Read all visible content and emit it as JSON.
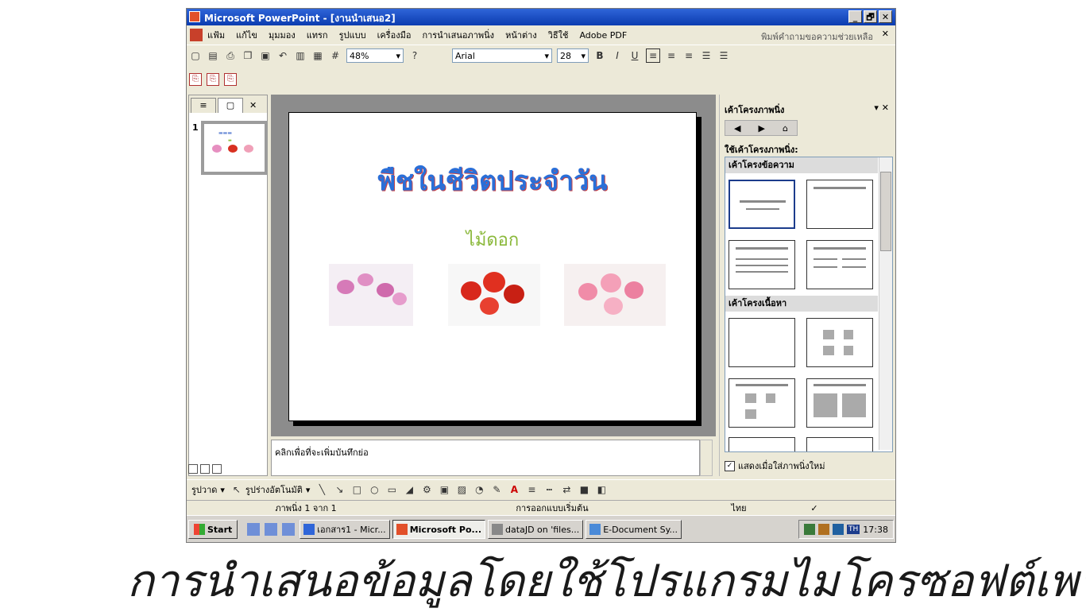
{
  "window": {
    "title": "Microsoft PowerPoint - [งานนำเสนอ2]",
    "buttons": [
      "_",
      "🗗",
      "✕"
    ]
  },
  "menu": {
    "items": [
      "แฟ้ม",
      "แก้ไข",
      "มุมมอง",
      "แทรก",
      "รูปแบบ",
      "เครื่องมือ",
      "การนำเสนอภาพนิ่ง",
      "หน้าต่าง",
      "วิธีใช้",
      "Adobe PDF"
    ],
    "help_placeholder": "พิมพ์คำถามขอความช่วยเหลือ",
    "close": "✕"
  },
  "toolbar": {
    "zoom": "48%",
    "font": "Arial",
    "font_size": "28",
    "bold": "B",
    "italic": "I",
    "underline": "U"
  },
  "left_pane": {
    "tab_close": "✕",
    "slide_number": "1"
  },
  "slide": {
    "title": "พืชในชีวิตประจำวัน",
    "subtitle": "ไม้ดอก"
  },
  "notes": {
    "placeholder": "คลิกเพื่อที่จะเพิ่มบันทึกย่อ"
  },
  "task_pane": {
    "title": "เค้าโครงภาพนิ่ง",
    "controls": "▾ ✕",
    "apply_label": "ใช้เค้าโครงภาพนิ่ง:",
    "section_text": "เค้าโครงข้อความ",
    "section_content": "เค้าโครงเนื้อหา",
    "show_checkbox": "แสดงเมื่อใส่ภาพนิ่งใหม่",
    "show_checked": true
  },
  "draw_toolbar": {
    "draw_label": "รูปวาด",
    "autoshapes_label": "รูปร่างอัตโนมัติ"
  },
  "status": {
    "slide": "ภาพนิ่ง 1 จาก 1",
    "design": "การออกแบบเริ่มต้น",
    "language": "ไทย"
  },
  "taskbar": {
    "start": "Start",
    "tasks": [
      "เอกสาร1 - Micr...",
      "Microsoft Po...",
      "dataJD on 'files...",
      "E-Document Sy..."
    ],
    "active_task": 1,
    "lang": "TH",
    "time": "17:38"
  },
  "caption": "การนำเสนอข้อมูลโดยใช้โปรแกรมไมโครซอฟต์เพาเวอร์พอยต์",
  "colors": {
    "title_blue": "#2a6fd8",
    "subtitle_green": "#8ab83a",
    "titlebar": "#0b3cb0"
  }
}
